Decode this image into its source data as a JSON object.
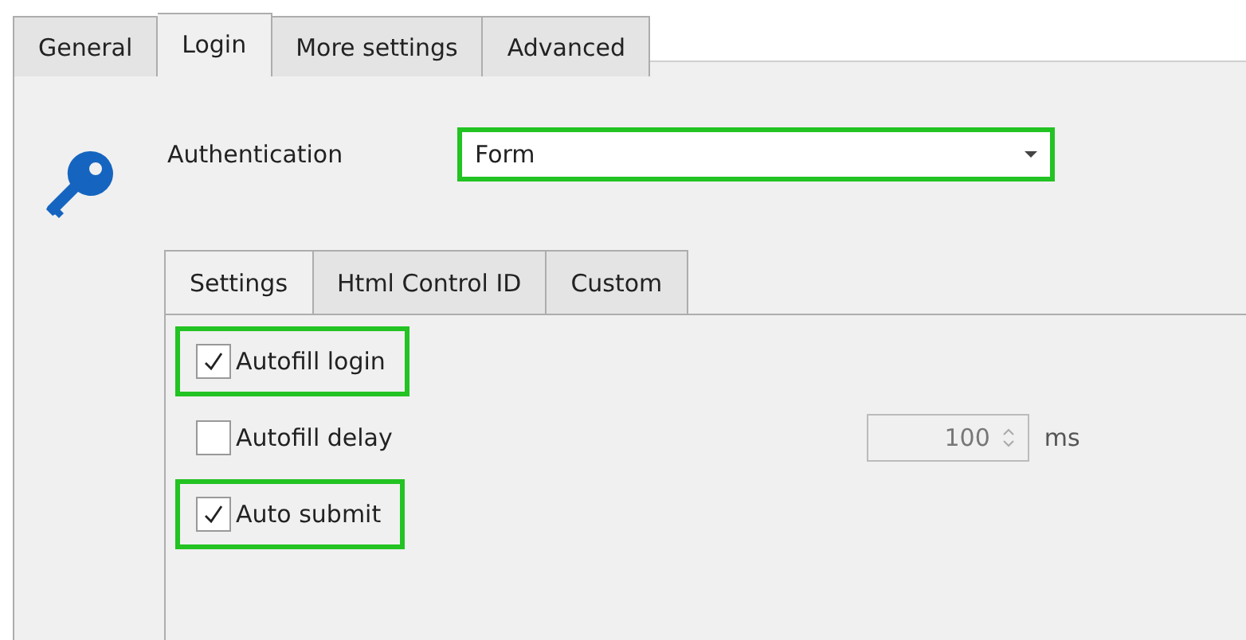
{
  "tabs": [
    {
      "label": "General",
      "selected": false
    },
    {
      "label": "Login",
      "selected": true
    },
    {
      "label": "More settings",
      "selected": false
    },
    {
      "label": "Advanced",
      "selected": false
    }
  ],
  "authentication": {
    "label": "Authentication",
    "value": "Form",
    "highlighted": true
  },
  "sub_tabs": [
    {
      "label": "Settings",
      "selected": true
    },
    {
      "label": "Html Control ID",
      "selected": false
    },
    {
      "label": "Custom",
      "selected": false
    }
  ],
  "options": [
    {
      "label": "Autofill login",
      "checked": true,
      "highlighted": true
    },
    {
      "label": "Autofill delay",
      "checked": false,
      "highlighted": false
    },
    {
      "label": "Auto submit",
      "checked": true,
      "highlighted": true
    }
  ],
  "delay": {
    "value": "100",
    "unit": "ms",
    "disabled": true
  }
}
